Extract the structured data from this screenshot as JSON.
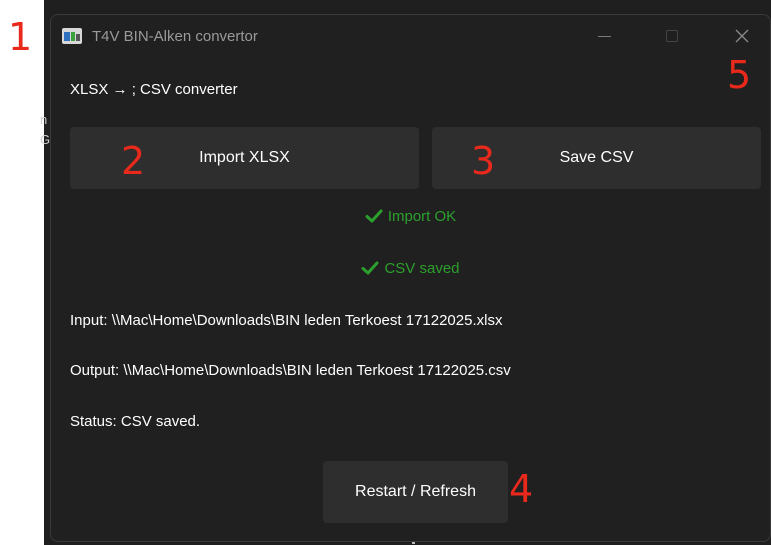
{
  "window": {
    "title": "T4V BIN-Alken convertor"
  },
  "subtitle": "XLSX → ; CSV converter",
  "buttons": {
    "import": "Import XLSX",
    "save": "Save CSV",
    "restart": "Restart / Refresh"
  },
  "indicators": {
    "import_ok": "Import OK",
    "csv_saved": "CSV saved",
    "color": "#2ca02c"
  },
  "info": {
    "input": "Input: \\\\Mac\\Home\\Downloads\\BIN leden Terkoest 17122025.xlsx",
    "output": "Output: \\\\Mac\\Home\\Downloads\\BIN leden Terkoest 17122025.csv",
    "status": "Status: CSV saved."
  },
  "annotations": [
    "1",
    "2",
    "3",
    "4",
    "5"
  ],
  "side_glyphs": [
    "n",
    "G"
  ],
  "icons": {
    "app": "app-icon",
    "minimize": "minimize-icon",
    "maximize": "maximize-icon",
    "close": "close-icon",
    "check": "checkmark-icon"
  },
  "annotation_color": "#e8291b"
}
